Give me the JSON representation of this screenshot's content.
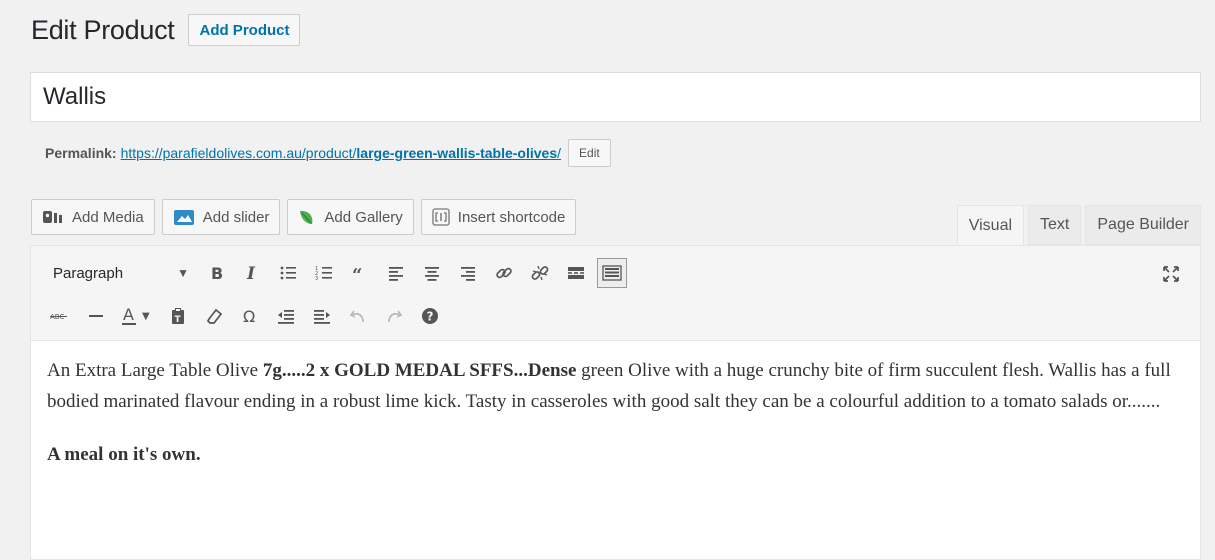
{
  "header": {
    "title": "Edit Product",
    "add_button": "Add Product"
  },
  "post_title": {
    "value": "Wallis"
  },
  "permalink": {
    "label": "Permalink:",
    "base": "https://parafieldolives.com.au/product/",
    "slug": "large-green-wallis-table-olives",
    "trailing": "/",
    "edit_label": "Edit"
  },
  "media_buttons": [
    {
      "label": "Add Media",
      "icon": "add-media-icon"
    },
    {
      "label": "Add slider",
      "icon": "slider-icon"
    },
    {
      "label": "Add Gallery",
      "icon": "leaf-icon"
    },
    {
      "label": "Insert shortcode",
      "icon": "shortcode-icon"
    }
  ],
  "editor_tabs": [
    {
      "label": "Visual",
      "active": true
    },
    {
      "label": "Text",
      "active": false
    },
    {
      "label": "Page Builder",
      "active": false
    }
  ],
  "toolbar": {
    "format_value": "Paragraph",
    "row1_icons": [
      "bold-icon",
      "italic-icon",
      "bullet-list-icon",
      "numbered-list-icon",
      "blockquote-icon",
      "align-left-icon",
      "align-center-icon",
      "align-right-icon",
      "link-icon",
      "unlink-icon",
      "read-more-icon",
      "toolbar-toggle-icon"
    ],
    "row2_icons": [
      "strikethrough-icon",
      "horizontal-line-icon",
      "text-color-icon",
      "paste-text-icon",
      "clear-formatting-icon",
      "special-character-icon",
      "outdent-icon",
      "indent-icon",
      "undo-icon",
      "redo-icon",
      "help-icon"
    ],
    "fullscreen_icon": "fullscreen-icon"
  },
  "content": {
    "p1_a": "An Extra Large Table Olive ",
    "p1_bold": "7g.....2 x GOLD MEDAL SFFS...Dense",
    "p1_b": " green Olive with a  huge crunchy bite of firm succulent flesh.  Wallis has a full bodied marinated flavour ending in a robust lime kick.  Tasty in casseroles with good salt they can be a colourful addition to a tomato salads or.......",
    "p2_bold": "A meal on it's own."
  }
}
